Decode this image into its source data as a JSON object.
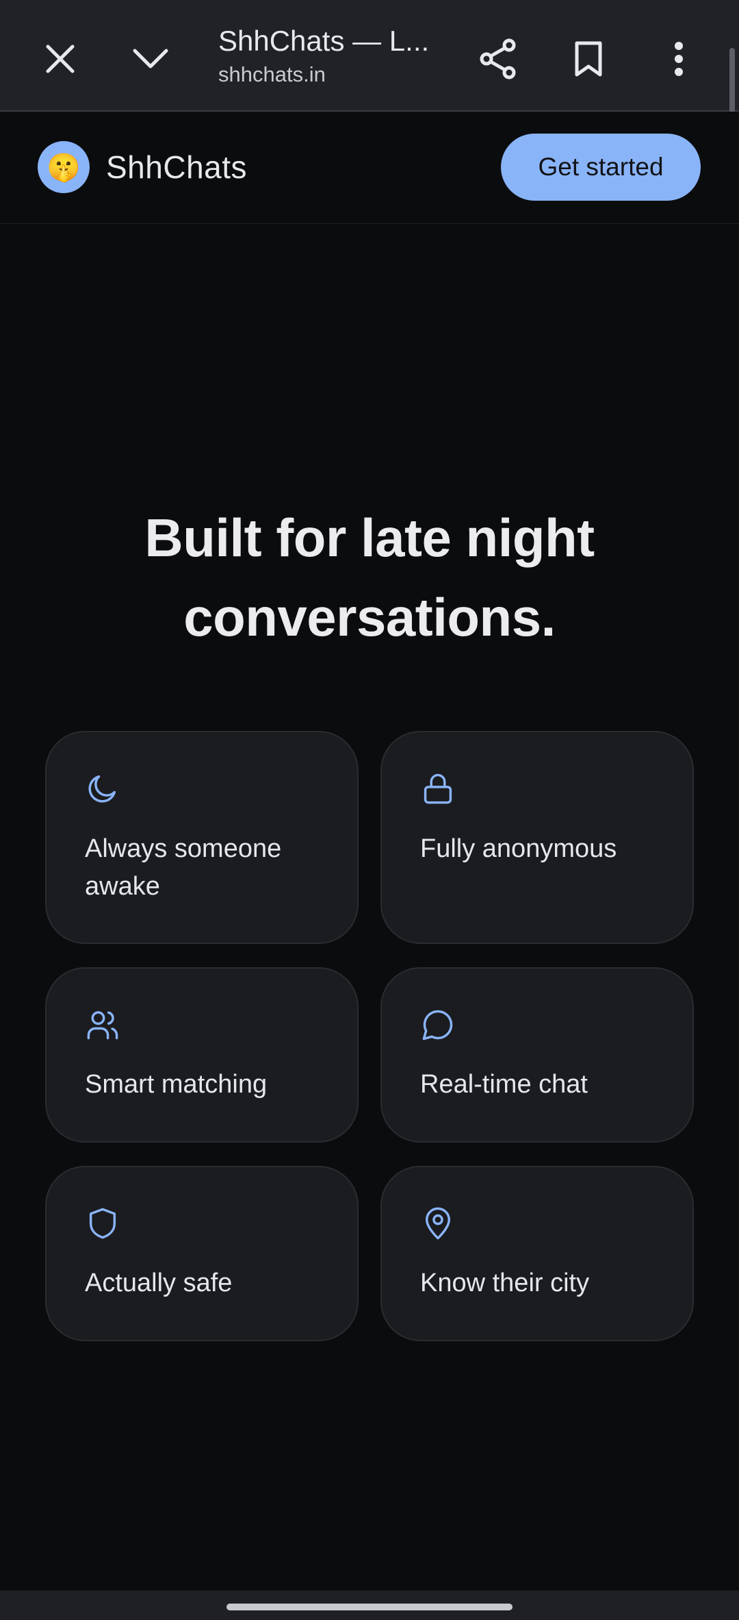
{
  "browser": {
    "tab_title": "ShhChats — L...",
    "url": "shhchats.in",
    "icons": {
      "close": "close-icon",
      "minimize": "chevron-down-icon",
      "share": "share-icon",
      "bookmark": "bookmark-icon",
      "more": "more-vert-icon"
    }
  },
  "header": {
    "logo_emoji": "🤫",
    "brand_name": "ShhChats",
    "cta_label": "Get started"
  },
  "hero": {
    "title_line1": "Built for late night",
    "title_line2": "conversations."
  },
  "features": [
    {
      "icon": "moon-icon",
      "label": "Always someone awake"
    },
    {
      "icon": "lock-icon",
      "label": "Fully anonymous"
    },
    {
      "icon": "users-icon",
      "label": "Smart matching"
    },
    {
      "icon": "chat-bubble-icon",
      "label": "Real-time chat"
    },
    {
      "icon": "shield-icon",
      "label": "Actually safe"
    },
    {
      "icon": "map-pin-icon",
      "label": "Know their city"
    }
  ],
  "colors": {
    "accent": "#8ab4f8",
    "background": "#0b0c0e",
    "card_background": "#1b1c20",
    "browser_bar": "#202226"
  }
}
